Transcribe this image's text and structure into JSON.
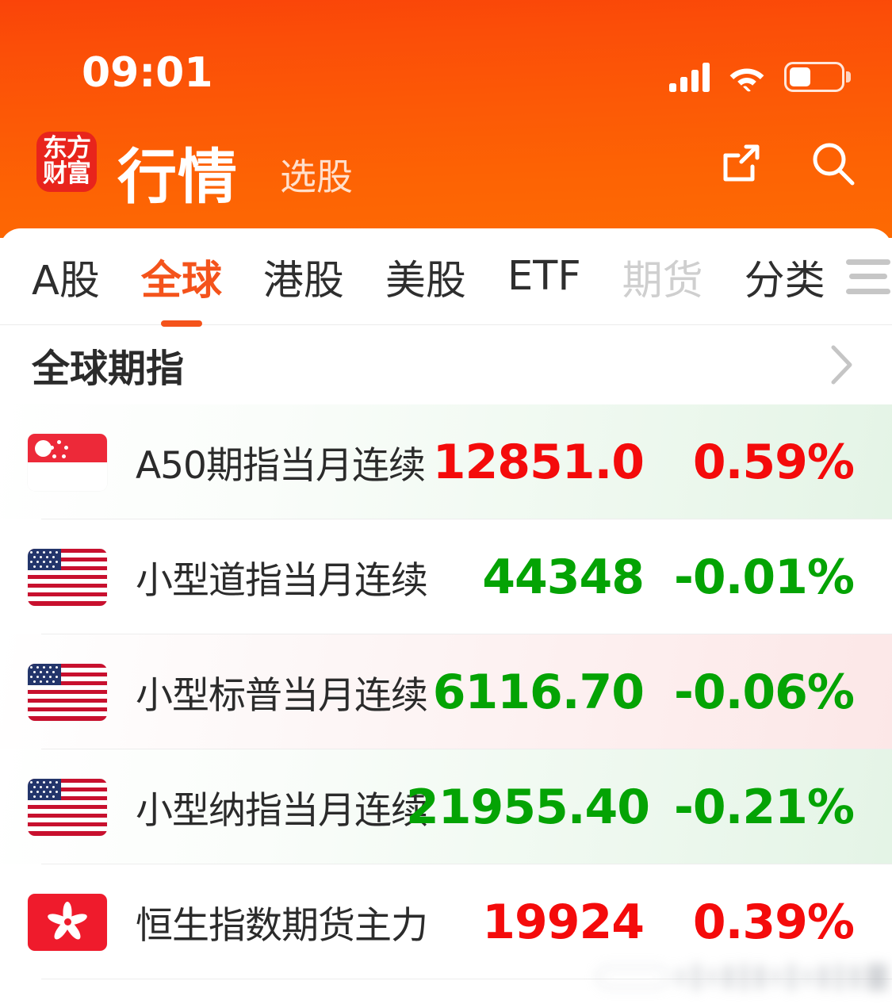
{
  "status_bar": {
    "time": "09:01",
    "signal_icon": "cellular-signal-icon",
    "wifi_icon": "wifi-icon",
    "battery_icon": "battery-icon"
  },
  "header": {
    "logo_line1": "东方",
    "logo_line2": "财富",
    "title": "行情",
    "subtitle": "选股",
    "share_icon": "share-external-link-icon",
    "search_icon": "search-icon",
    "brand_color": "#f4531b",
    "logo_color": "#e8241c"
  },
  "tabs": {
    "items": [
      {
        "label": "A股",
        "active": false,
        "faded": false
      },
      {
        "label": "全球",
        "active": true,
        "faded": false
      },
      {
        "label": "港股",
        "active": false,
        "faded": false
      },
      {
        "label": "美股",
        "active": false,
        "faded": false
      },
      {
        "label": "ETF",
        "active": false,
        "faded": false
      },
      {
        "label": "期货",
        "active": false,
        "faded": true
      },
      {
        "label": "分类",
        "active": false,
        "faded": false
      }
    ],
    "menu_icon": "hamburger-menu-icon"
  },
  "section": {
    "title": "全球期指",
    "chevron_icon": "chevron-right-icon"
  },
  "quotes": [
    {
      "flag": "singapore-flag",
      "name": "A50期指当月连续",
      "price": "12851.0",
      "change_pct": "0.59%",
      "direction": "up",
      "row_bg": "up"
    },
    {
      "flag": "united-states-flag",
      "name": "小型道指当月连续",
      "price": "44348",
      "change_pct": "-0.01%",
      "direction": "down",
      "row_bg": "plain"
    },
    {
      "flag": "united-states-flag",
      "name": "小型标普当月连续",
      "price": "6116.70",
      "change_pct": "-0.06%",
      "direction": "down",
      "row_bg": "down"
    },
    {
      "flag": "united-states-flag",
      "name": "小型纳指当月连续",
      "price": "21955.40",
      "change_pct": "-0.21%",
      "direction": "down",
      "row_bg": "up"
    },
    {
      "flag": "hong-kong-flag",
      "name": "恒生指数期货主力",
      "price": "19924",
      "change_pct": "0.39%",
      "direction": "up",
      "row_bg": "plain"
    }
  ],
  "colors": {
    "up": "#f40b0b",
    "down": "#04a304",
    "accent": "#f4531b"
  }
}
